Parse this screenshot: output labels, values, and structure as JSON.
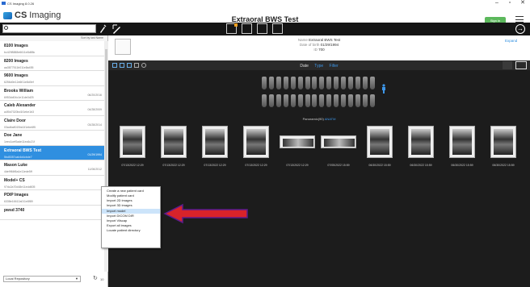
{
  "window": {
    "title": "CS Imaging 8.0.26",
    "minimize": "–",
    "maximize": "▫",
    "close": "✕"
  },
  "header": {
    "brand_cs": "CS",
    "brand_imaging": "Imaging",
    "title": "Extraoral BWS Test",
    "signin_label": "Sign in"
  },
  "search": {
    "value": ""
  },
  "patient_info": {
    "name_label": "Name",
    "name": "Extraoral BWS Test",
    "dob_label": "Date of birth",
    "dob": "01/29/1994",
    "id_label": "ID",
    "id": "700",
    "expand_label": "Expand"
  },
  "sort_label": "Sort by last Name",
  "patients": [
    {
      "name": "8100 Images",
      "id": "bc4298888e6611e8d88c",
      "date": ""
    },
    {
      "name": "8200 Images",
      "id": "aa3877511b011e8a455",
      "date": ""
    },
    {
      "name": "9600 Images",
      "id": "6256d0e12d6f11e8d0ef",
      "date": ""
    },
    {
      "name": "Brooks William",
      "id": "6953dd04c1e11de0d25",
      "date": "06/20/2016"
    },
    {
      "name": "Caleb Alexander",
      "id": "a4f0d7020bd1f1ebe1b3",
      "date": "04/28/2009"
    },
    {
      "name": "Claire Door",
      "id": "03ad6a8020bd1f1ebe6f5",
      "date": "03/28/2014"
    },
    {
      "name": "Doe Jane",
      "id": "1eec1cef0ade11ec6c21f",
      "date": ""
    },
    {
      "name": "Extraoral BWS Test",
      "id": "5bd5357cab4d4cbde7",
      "date": "01/29/1994"
    },
    {
      "name": "Mason Luke",
      "id": "4de9f66f6a1e11ede5ff",
      "date": "11/06/2012"
    },
    {
      "name": "Model+ CS",
      "id": "97dc2a70d48e11edd605",
      "date": ""
    },
    {
      "name": "PDIP Images",
      "id": "6338e16612a011e8f89",
      "date": ""
    },
    {
      "name": "pwsd 3740",
      "id": "",
      "date": ""
    }
  ],
  "repository": {
    "value": "Local Repository",
    "count": "10"
  },
  "viewer": {
    "tab_date": "Date",
    "tab_type": "Type",
    "tab_filter": "Filter",
    "pano_label": "Panoramic(90)",
    "pano_suffix": "ANATM"
  },
  "thumbnails": [
    {
      "date": "07/13/2022 12:29",
      "kind": "bw"
    },
    {
      "date": "07/13/2022 12:29",
      "kind": "bw"
    },
    {
      "date": "07/13/2022 12:29",
      "kind": "bw"
    },
    {
      "date": "07/13/2022 12:29",
      "kind": "bw"
    },
    {
      "date": "07/13/2022 12:29",
      "kind": "pano"
    },
    {
      "date": "07/05/2022 15:59",
      "kind": "pano"
    },
    {
      "date": "06/30/2022 15:59",
      "kind": "bw"
    },
    {
      "date": "06/30/2022 15:59",
      "kind": "bw"
    },
    {
      "date": "06/30/2022 15:59",
      "kind": "bw"
    },
    {
      "date": "06/30/2022 15:59",
      "kind": "bw"
    }
  ],
  "context_menu": [
    "Create a new patient card",
    "Modify patient card",
    "Import 2D images",
    "Import 3D images",
    "Import model",
    "Import DICOM DIR",
    "Import Vilscap",
    "Export all images",
    "Locate patient directory"
  ],
  "context_menu_highlight": 4,
  "colors": {
    "accent": "#2f8fe0",
    "signin": "#5cb85c",
    "arrow": "#d8232a"
  }
}
